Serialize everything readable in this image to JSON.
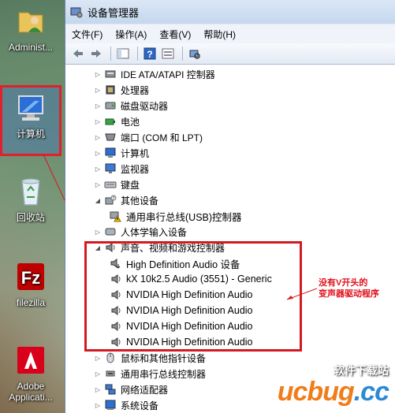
{
  "desktop": {
    "icons": [
      {
        "label": "Administ..."
      },
      {
        "label": "计算机"
      },
      {
        "label": "回收站"
      },
      {
        "label": "filezilla"
      },
      {
        "label": "Adobe Applicati..."
      }
    ]
  },
  "window": {
    "title": "设备管理器",
    "menu": [
      "文件(F)",
      "操作(A)",
      "查看(V)",
      "帮助(H)"
    ],
    "tree": [
      {
        "label": "IDE ATA/ATAPI 控制器",
        "icon": "ide-controller-icon"
      },
      {
        "label": "处理器",
        "icon": "processor-icon"
      },
      {
        "label": "磁盘驱动器",
        "icon": "disk-drive-icon"
      },
      {
        "label": "电池",
        "icon": "battery-icon"
      },
      {
        "label": "端口 (COM 和 LPT)",
        "icon": "port-icon"
      },
      {
        "label": "计算机",
        "icon": "computer-icon"
      },
      {
        "label": "监视器",
        "icon": "monitor-icon"
      },
      {
        "label": "键盘",
        "icon": "keyboard-icon"
      },
      {
        "label": "其他设备",
        "icon": "other-devices-icon",
        "expanded": true
      },
      {
        "label": "通用串行总线(USB)控制器",
        "icon": "warning-device-icon",
        "child": true
      },
      {
        "label": "人体学输入设备",
        "icon": "hid-icon"
      },
      {
        "label": "声音、视频和游戏控制器",
        "icon": "speaker-icon",
        "expanded": true
      },
      {
        "label": "High Definition Audio 设备",
        "icon": "speaker-download-icon",
        "child": true
      },
      {
        "label": "kX 10k2.5 Audio (3551) - Generic",
        "icon": "speaker-icon",
        "child": true
      },
      {
        "label": "NVIDIA High Definition Audio",
        "icon": "speaker-icon",
        "child": true
      },
      {
        "label": "NVIDIA High Definition Audio",
        "icon": "speaker-icon",
        "child": true
      },
      {
        "label": "NVIDIA High Definition Audio",
        "icon": "speaker-icon",
        "child": true
      },
      {
        "label": "NVIDIA High Definition Audio",
        "icon": "speaker-icon",
        "child": true
      },
      {
        "label": "鼠标和其他指针设备",
        "icon": "mouse-icon"
      },
      {
        "label": "通用串行总线控制器",
        "icon": "usb-icon"
      },
      {
        "label": "网络适配器",
        "icon": "network-icon"
      },
      {
        "label": "系统设备",
        "icon": "system-icon"
      }
    ]
  },
  "annotation": {
    "text_line1": "没有V开头的",
    "text_line2": "变声器驱动程序",
    "color": "#d21a22"
  },
  "watermark": {
    "top": "软件下载站",
    "main": "ucbug",
    "suffix": ".cc"
  }
}
